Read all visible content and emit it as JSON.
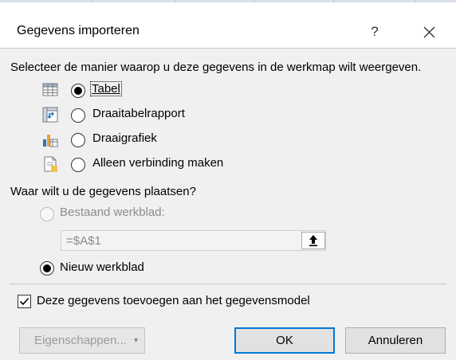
{
  "dialog": {
    "title": "Gegevens importeren",
    "help_glyph": "?",
    "instruction": "Selecteer de manier waarop u deze gegevens in de werkmap wilt weergeven.",
    "view_options": [
      {
        "label": "Tabel",
        "selected": true,
        "icon": "table-icon"
      },
      {
        "label": "Draaitabelrapport",
        "selected": false,
        "icon": "pivot-table-icon"
      },
      {
        "label": "Draaigrafiek",
        "selected": false,
        "icon": "pivot-chart-icon"
      },
      {
        "label": "Alleen verbinding maken",
        "selected": false,
        "icon": "connection-only-icon"
      }
    ],
    "placement_question": "Waar wilt u de gegevens plaatsen?",
    "existing_sheet_label": "Bestaand werkblad:",
    "existing_sheet_ref": "=$A$1",
    "new_sheet_label": "Nieuw werkblad",
    "add_to_model_label": "Deze gegevens toevoegen aan het gegevensmodel",
    "add_to_model_checked": true,
    "buttons": {
      "properties": "Eigenschappen...",
      "ok": "OK",
      "cancel": "Annuleren"
    }
  },
  "colors": {
    "dialog_bg": "#f0f0f0",
    "title_bg": "#ffffff",
    "default_button_border": "#0078d7",
    "disabled_text": "#8c8c8c"
  }
}
